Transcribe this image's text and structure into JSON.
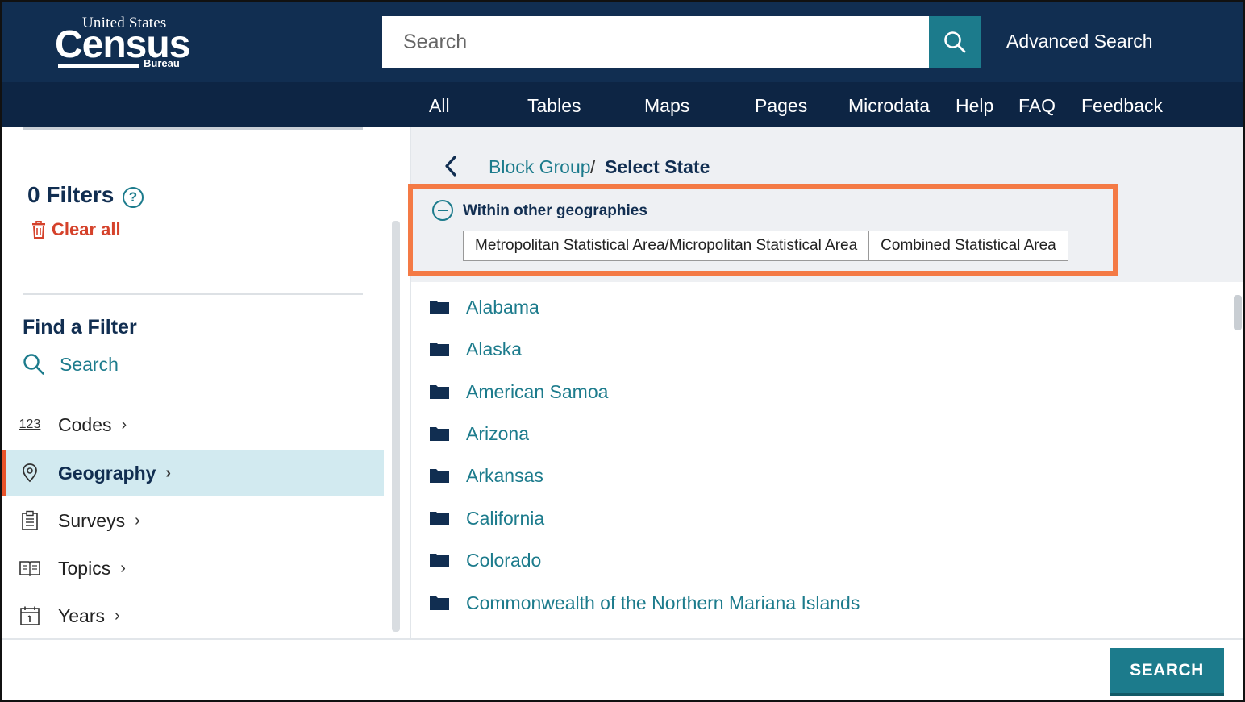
{
  "header": {
    "logo": {
      "line1": "United States",
      "line2": "Census",
      "line3": "Bureau"
    },
    "search_placeholder": "Search",
    "advanced_search": "Advanced Search"
  },
  "nav": {
    "items": [
      "All",
      "Tables",
      "Maps",
      "Pages",
      "Microdata",
      "Help",
      "FAQ",
      "Feedback"
    ]
  },
  "sidebar": {
    "filters_title": "0 Filters",
    "help_symbol": "?",
    "clear_all": "Clear all",
    "find_filter_title": "Find a Filter",
    "search_label": "Search",
    "items": [
      {
        "label": "Codes",
        "icon": "codes-123-icon",
        "icon_text": "123",
        "active": false
      },
      {
        "label": "Geography",
        "icon": "map-pin-icon",
        "active": true
      },
      {
        "label": "Surveys",
        "icon": "clipboard-icon",
        "active": false
      },
      {
        "label": "Topics",
        "icon": "book-icon",
        "active": false
      },
      {
        "label": "Years",
        "icon": "calendar-icon",
        "active": false
      }
    ]
  },
  "main": {
    "breadcrumb": {
      "link": "Block Group",
      "separator": "/",
      "current": "Select State"
    },
    "within": {
      "label": "Within other geographies",
      "tabs": [
        "Metropolitan Statistical Area/Micropolitan Statistical Area",
        "Combined Statistical Area"
      ]
    },
    "states": [
      "Alabama",
      "Alaska",
      "American Samoa",
      "Arizona",
      "Arkansas",
      "California",
      "Colorado",
      "Commonwealth of the Northern Mariana Islands"
    ]
  },
  "footer": {
    "search_button": "SEARCH"
  },
  "colors": {
    "header_bg": "#112e51",
    "nav_bg": "#0d2544",
    "teal": "#1c7b8c",
    "accent_orange": "#f47a45",
    "clear_red": "#d5422b",
    "active_bg": "#d2eaf0"
  }
}
